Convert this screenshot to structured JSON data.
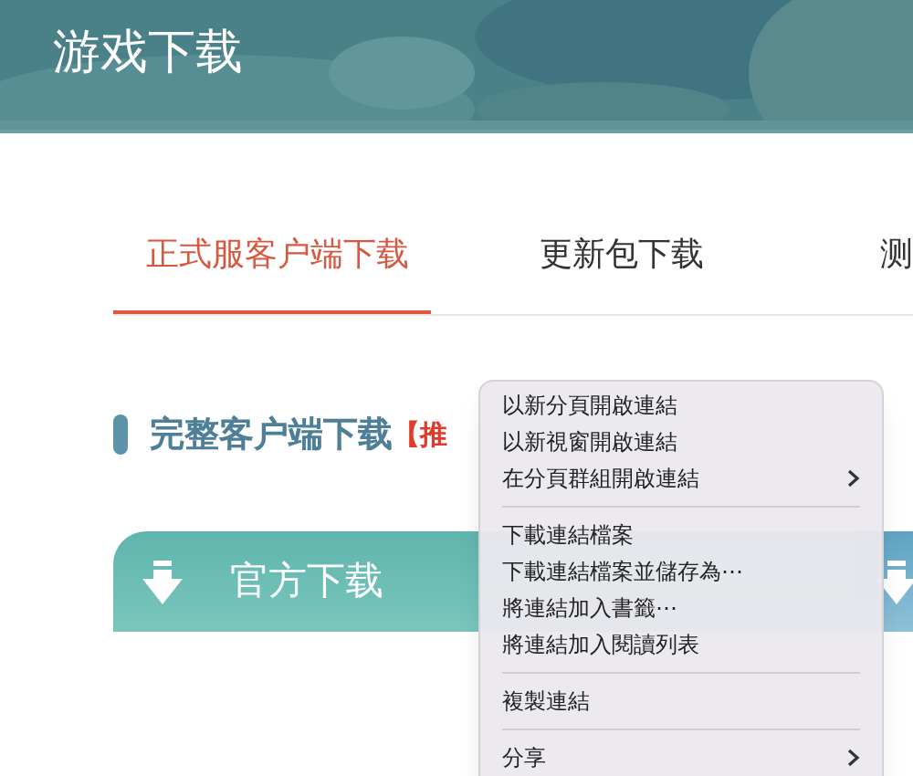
{
  "header": {
    "title": "游戏下载"
  },
  "tabs": [
    {
      "label": "正式服客户端下载",
      "selected": true
    },
    {
      "label": "更新包下载",
      "selected": false
    },
    {
      "label": "测",
      "selected": false
    }
  ],
  "section": {
    "title": "完整客户端下载",
    "tag": "【推"
  },
  "download_buttons": [
    {
      "label": "官方下载"
    }
  ],
  "context_menu": [
    {
      "kind": "item",
      "label": "以新分頁開啟連結",
      "submenu": false
    },
    {
      "kind": "item",
      "label": "以新視窗開啟連結",
      "submenu": false
    },
    {
      "kind": "item",
      "label": "在分頁群組開啟連結",
      "submenu": true
    },
    {
      "kind": "separator"
    },
    {
      "kind": "item",
      "label": "下載連結檔案",
      "submenu": false
    },
    {
      "kind": "item",
      "label": "下載連結檔案並儲存為⋯",
      "submenu": false
    },
    {
      "kind": "item",
      "label": "將連結加入書籤⋯",
      "submenu": false
    },
    {
      "kind": "item",
      "label": "將連結加入閱讀列表",
      "submenu": false
    },
    {
      "kind": "separator"
    },
    {
      "kind": "item",
      "label": "複製連結",
      "submenu": false
    },
    {
      "kind": "separator"
    },
    {
      "kind": "item",
      "label": "分享",
      "submenu": true
    }
  ]
}
